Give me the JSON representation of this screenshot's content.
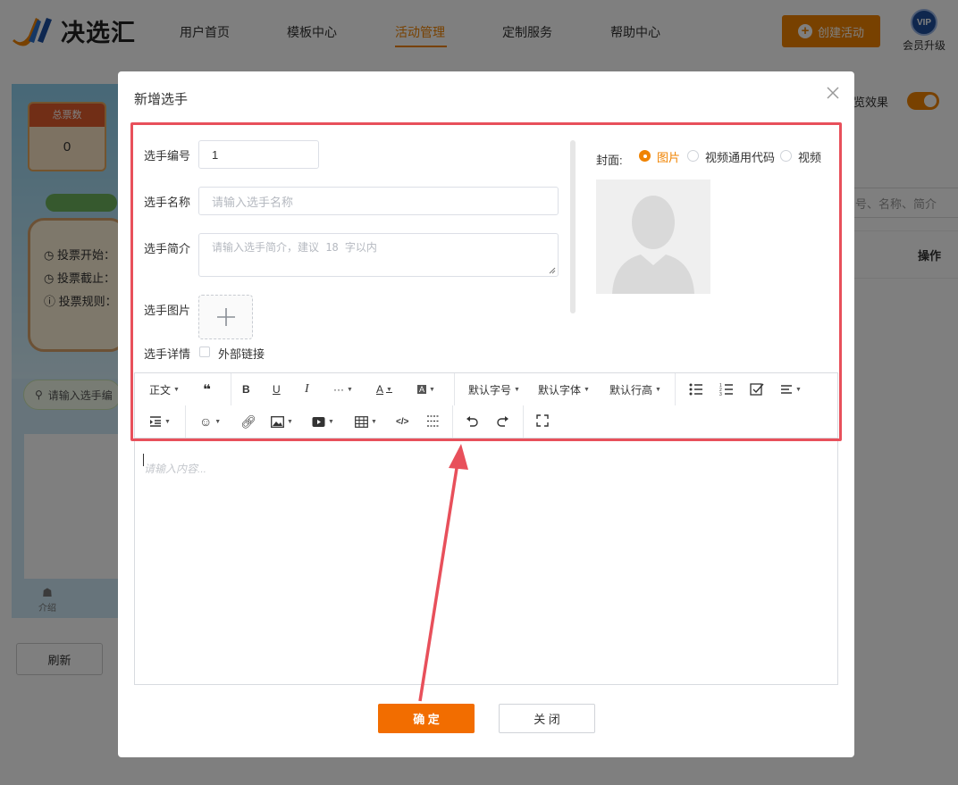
{
  "nav": {
    "logo_text": "决选汇",
    "items": [
      "用户首页",
      "模板中心",
      "活动管理",
      "定制服务",
      "帮助中心"
    ],
    "active_index": 2,
    "create_button": "创建活动",
    "vip_badge": "VIP",
    "vip_label": "会员升级"
  },
  "background": {
    "total_votes_label": "总票数",
    "total_votes_value": "0",
    "info_lines": [
      "投票开始：",
      "投票截止：",
      "投票规则："
    ],
    "search_placeholder": "请输入选手编",
    "tab_intro": "介绍",
    "refresh_button": "刷新",
    "preview_label": "览效果",
    "list_search_placeholder": "号、名称、简介",
    "operation_header": "操作"
  },
  "dialog": {
    "title": "新增选手",
    "fields": {
      "number_label": "选手编号",
      "number_value": "1",
      "name_label": "选手名称",
      "name_placeholder": "请输入选手名称",
      "intro_label": "选手简介",
      "intro_placeholder": "请输入选手简介，建议 18 字以内",
      "image_label": "选手图片",
      "detail_label": "选手详情",
      "external_link_label": "外部链接"
    },
    "cover": {
      "label": "封面:",
      "options": [
        "图片",
        "视频通用代码",
        "视频"
      ],
      "selected_index": 0
    },
    "toolbar": {
      "paragraph": "正文",
      "font_size": "默认字号",
      "font_family": "默认字体",
      "line_height": "默认行高",
      "more": "···"
    },
    "editor_placeholder": "请输入内容...",
    "confirm_button": "确 定",
    "close_button": "关 闭"
  },
  "colors": {
    "accent": "#f08300",
    "confirm": "#f26d00",
    "annotation": "#e8505b"
  }
}
